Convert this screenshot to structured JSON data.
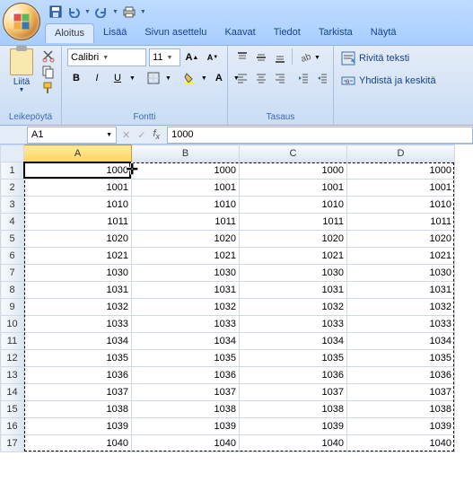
{
  "qat": {
    "save": "save-icon",
    "undo": "undo-icon",
    "redo": "redo-icon",
    "print": "print-icon"
  },
  "tabs": [
    "Aloitus",
    "Lisää",
    "Sivun asettelu",
    "Kaavat",
    "Tiedot",
    "Tarkista",
    "Näytä"
  ],
  "active_tab": 0,
  "ribbon": {
    "clipboard": {
      "paste": "Liitä",
      "label": "Leikepöytä"
    },
    "font": {
      "name": "Calibri",
      "size": "11",
      "label": "Fontti",
      "bold": "B",
      "italic": "I",
      "underline": "U"
    },
    "alignment": {
      "label": "Tasaus"
    },
    "wraptext": "Rivitä teksti",
    "merge": "Yhdistä ja keskitä"
  },
  "namebox": "A1",
  "formula": "1000",
  "columns": [
    "A",
    "B",
    "C",
    "D"
  ],
  "rows": [
    1,
    2,
    3,
    4,
    5,
    6,
    7,
    8,
    9,
    10,
    11,
    12,
    13,
    14,
    15,
    16,
    17
  ],
  "cells": [
    [
      1000,
      1000,
      1000,
      1000
    ],
    [
      1001,
      1001,
      1001,
      1001
    ],
    [
      1010,
      1010,
      1010,
      1010
    ],
    [
      1011,
      1011,
      1011,
      1011
    ],
    [
      1020,
      1020,
      1020,
      1020
    ],
    [
      1021,
      1021,
      1021,
      1021
    ],
    [
      1030,
      1030,
      1030,
      1030
    ],
    [
      1031,
      1031,
      1031,
      1031
    ],
    [
      1032,
      1032,
      1032,
      1032
    ],
    [
      1033,
      1033,
      1033,
      1033
    ],
    [
      1034,
      1034,
      1034,
      1034
    ],
    [
      1035,
      1035,
      1035,
      1035
    ],
    [
      1036,
      1036,
      1036,
      1036
    ],
    [
      1037,
      1037,
      1037,
      1037
    ],
    [
      1038,
      1038,
      1038,
      1038
    ],
    [
      1039,
      1039,
      1039,
      1039
    ],
    [
      1040,
      1040,
      1040,
      1040
    ]
  ],
  "selected_cell": "A1",
  "colors": {
    "accent": "#ffd557"
  }
}
